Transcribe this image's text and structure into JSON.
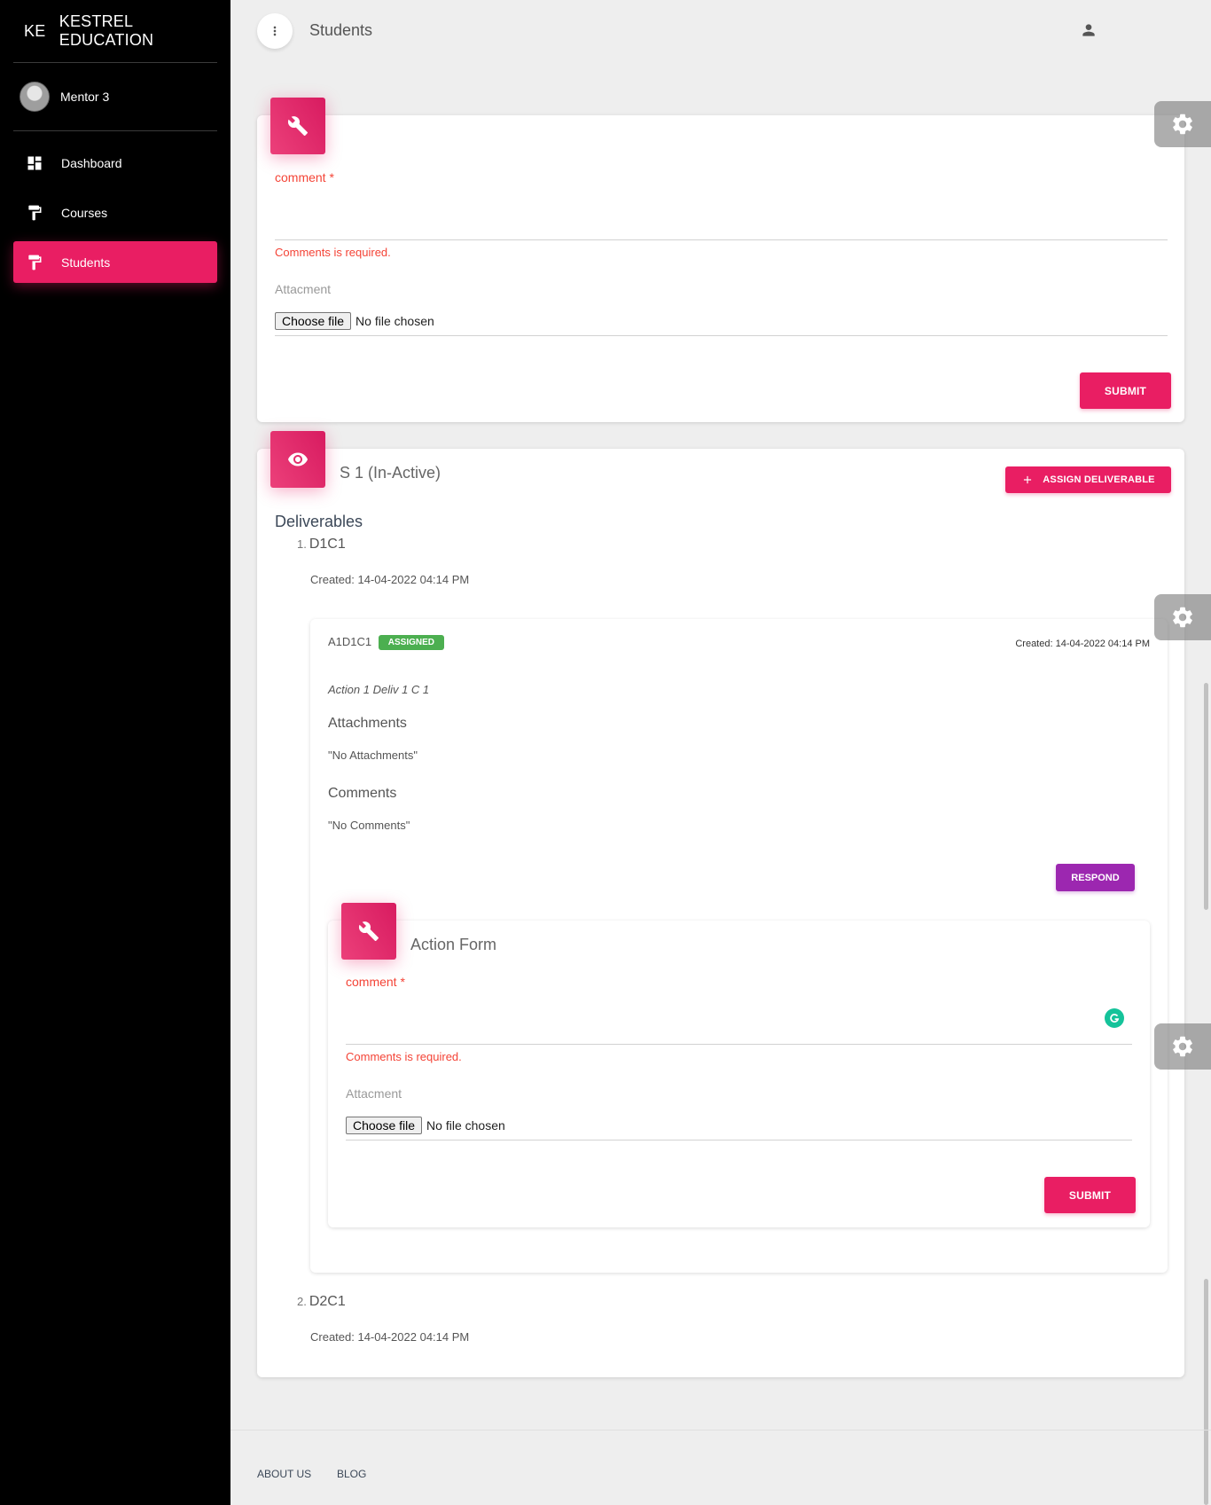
{
  "brand": {
    "mini": "KE",
    "name": "KESTREL EDUCATION"
  },
  "user": {
    "name": "Mentor 3"
  },
  "nav": [
    {
      "label": "Dashboard",
      "icon": "dashboard-icon"
    },
    {
      "label": "Courses",
      "icon": "format-paint-icon"
    },
    {
      "label": "Students",
      "icon": "format-paint-icon",
      "active": true
    }
  ],
  "topbar": {
    "title": "Students"
  },
  "comment_form": {
    "comment_label": "comment *",
    "error": "Comments is required.",
    "attachment_label": "Attacment",
    "choose_file": "Choose file",
    "no_file": "No file chosen",
    "submit": "SUBMIT"
  },
  "student_card": {
    "title": "S 1 (In-Active)",
    "assign_button": "ASSIGN DELIVERABLE",
    "deliverables_heading": "Deliverables",
    "deliverables": [
      {
        "num": "1.",
        "name": "D1C1",
        "created": "Created: 14-04-2022 04:14 PM"
      },
      {
        "num": "2.",
        "name": "D2C1",
        "created": "Created: 14-04-2022 04:14 PM"
      }
    ],
    "action": {
      "code": "A1D1C1",
      "badge": "ASSIGNED",
      "created": "Created: 14-04-2022 04:14 PM",
      "description": "Action 1 Deliv 1 C 1",
      "attachments_heading": "Attachments",
      "attachments_value": "\"No Attachments\"",
      "comments_heading": "Comments",
      "comments_value": "\"No Comments\"",
      "respond": "RESPOND"
    },
    "action_form": {
      "title": "Action Form",
      "comment_label": "comment *",
      "error": "Comments is required.",
      "attachment_label": "Attacment",
      "choose_file": "Choose file",
      "no_file": "No file chosen",
      "submit": "SUBMIT"
    }
  },
  "footer": {
    "links": [
      "ABOUT US",
      "BLOG"
    ]
  },
  "colors": {
    "accent": "#e91e63",
    "purple": "#9c27b0",
    "success": "#4caf50",
    "error": "#f44336",
    "sidebar": "#000000"
  }
}
